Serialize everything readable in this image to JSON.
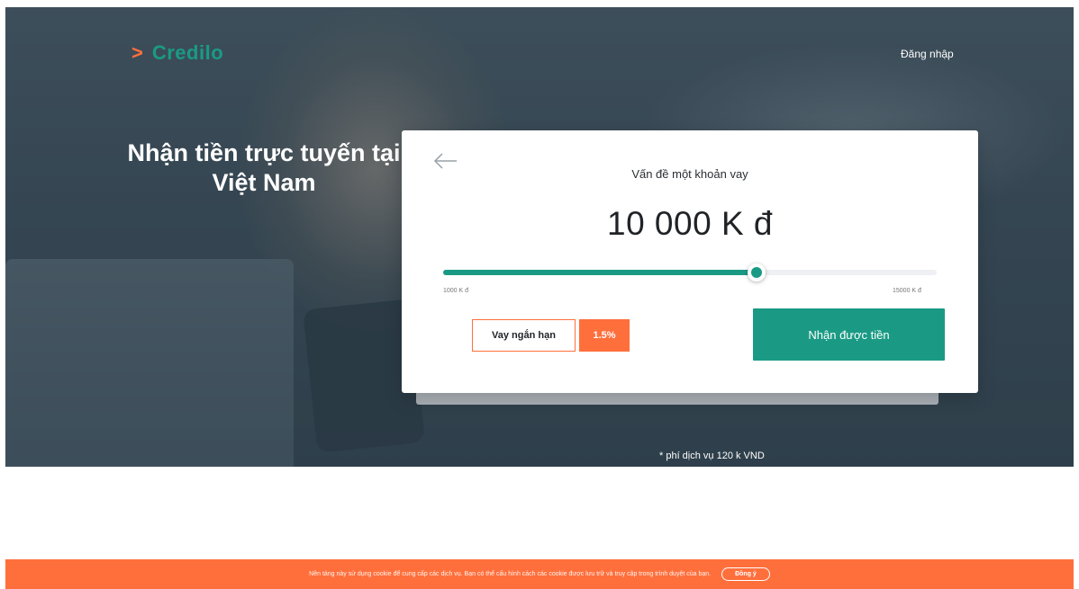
{
  "header": {
    "brand": "Credilo",
    "brand_icon": "chevron-right-icon",
    "login_label": "Đăng nhập"
  },
  "hero": {
    "title": "Nhận tiền trực tuyến tại Việt Nam",
    "fee_note": "* phí dịch vụ 120 k VND"
  },
  "loan_card": {
    "title": "Vấn đề một khoản vay",
    "amount": "10 000 K đ",
    "slider": {
      "min_label": "1000 K đ",
      "max_label": "15000 K đ",
      "fill_fraction": 0.635
    },
    "term_label": "Vay ngắn hạn",
    "rate_label": "1.5%",
    "cta_label": "Nhận được tiền"
  },
  "cookie_bar": {
    "text": "Nền tảng này sử dụng cookie để cung cấp các dịch vụ. Bạn có thể cấu hình cách các cookie được lưu trữ và truy cập trong trình duyệt của bạn.",
    "accept_label": "Đồng ý"
  },
  "colors": {
    "brand_green": "#1a9a84",
    "accent_orange": "#ff6f3c"
  }
}
